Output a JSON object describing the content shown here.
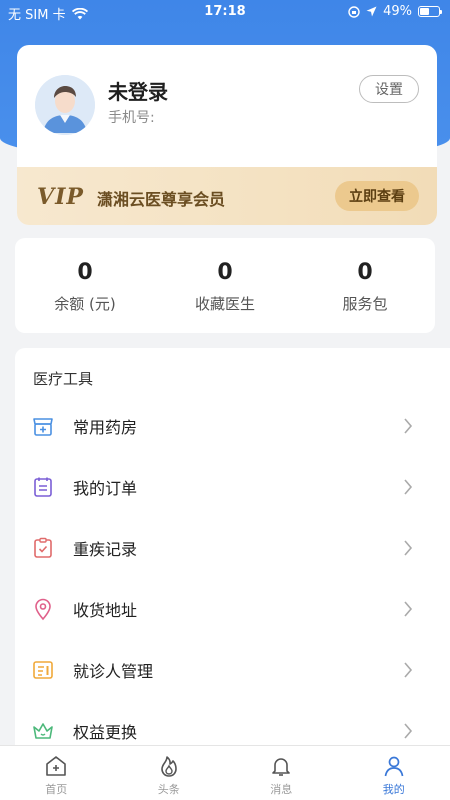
{
  "status_bar": {
    "carrier": "无 SIM 卡",
    "time": "17:18",
    "battery": "49%",
    "battery_level": 0.49
  },
  "profile": {
    "name": "未登录",
    "phone_label": "手机号:",
    "settings_label": "设置"
  },
  "vip": {
    "logo": "VIP",
    "text": "潇湘云医尊享会员",
    "button": "立即查看"
  },
  "stats": [
    {
      "value": "0",
      "label": "余额 (元)"
    },
    {
      "value": "0",
      "label": "收藏医生"
    },
    {
      "value": "0",
      "label": "服务包"
    }
  ],
  "tools": {
    "title": "医疗工具",
    "items": [
      {
        "label": "常用药房",
        "icon": "pharmacy-icon",
        "color": "#4a90e2"
      },
      {
        "label": "我的订单",
        "icon": "order-icon",
        "color": "#7b5fd6"
      },
      {
        "label": "重疾记录",
        "icon": "record-icon",
        "color": "#e06b6b"
      },
      {
        "label": "收货地址",
        "icon": "location-icon",
        "color": "#e0608a"
      },
      {
        "label": "就诊人管理",
        "icon": "patient-card-icon",
        "color": "#f0a93a"
      },
      {
        "label": "权益更换",
        "icon": "crown-icon",
        "color": "#4cb87a"
      }
    ]
  },
  "tab_bar": [
    {
      "label": "首页",
      "icon": "home-icon",
      "active": false
    },
    {
      "label": "头条",
      "icon": "flame-icon",
      "active": false
    },
    {
      "label": "消息",
      "icon": "bell-icon",
      "active": false
    },
    {
      "label": "我的",
      "icon": "person-icon",
      "active": true
    }
  ],
  "colors": {
    "primary": "#4a90ec",
    "vip_gold": "#ecc98e",
    "tab_active": "#3a78d8"
  }
}
